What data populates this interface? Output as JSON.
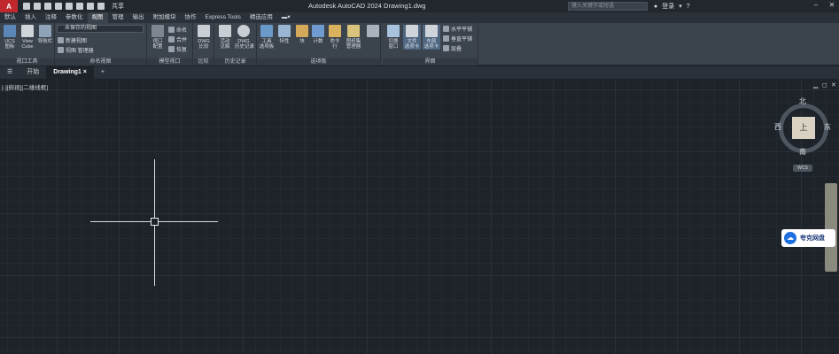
{
  "app": {
    "logo": "A",
    "title": "Autodesk AutoCAD 2024   Drawing1.dwg"
  },
  "quick_access": {
    "share": "共享"
  },
  "search": {
    "placeholder": "键入关键字或短语"
  },
  "account": {
    "signin": "登录"
  },
  "ribbon_tabs": [
    "默认",
    "插入",
    "注释",
    "参数化",
    "视图",
    "管理",
    "输出",
    "附加模块",
    "协作",
    "Express Tools",
    "精选应用"
  ],
  "ribbon": {
    "viewport_tools": {
      "title": "视口工具",
      "ucs": "UCS\n图标",
      "viewcube": "View\nCube",
      "navbar": "导航栏"
    },
    "named_views": {
      "title": "命名视图",
      "dropdown": "未保存的视图",
      "new_view": "新建视图",
      "view_manager": "视图 管理器"
    },
    "model_viewports": {
      "title": "模型视口",
      "config": "视口\n配置",
      "named": "命名",
      "join": "合并",
      "restore": "恢复"
    },
    "compare": {
      "title": "比较",
      "dwg_compare": "DWG\n比较"
    },
    "history": {
      "title": "历史记录",
      "activity": "活动\n见解",
      "dwg_history": "DWG\n历史记录"
    },
    "palettes": {
      "title": "选项板",
      "tool_palettes": "工具\n选项板",
      "properties": "特性",
      "block": "块",
      "calc": "计数",
      "command": "命令\n行",
      "sheet_set": "图纸集\n管理器",
      "more": ""
    },
    "interface": {
      "title": "界面",
      "switch_windows": "切换\n窗口",
      "file_tabs": "文件\n选项卡",
      "layout_tabs": "布局\n选项卡",
      "tile_h": "水平平铺",
      "tile_v": "垂直平铺",
      "cascade": "层叠"
    }
  },
  "file_tabs": {
    "start": "开始",
    "drawing": "Drawing1"
  },
  "viewport": {
    "label": "[-][俯视][二维线框]",
    "min": "▁",
    "restore": "◻",
    "close": "✕"
  },
  "viewcube": {
    "top": "上",
    "north": "北",
    "south": "南",
    "east": "东",
    "west": "西",
    "ucs": "WCS"
  },
  "overlay": {
    "cloud": "夸克网盘"
  },
  "colors": {
    "accent": "#c0282d",
    "canvas_bg": "#1e2329",
    "ribbon_bg": "#3b434c"
  }
}
